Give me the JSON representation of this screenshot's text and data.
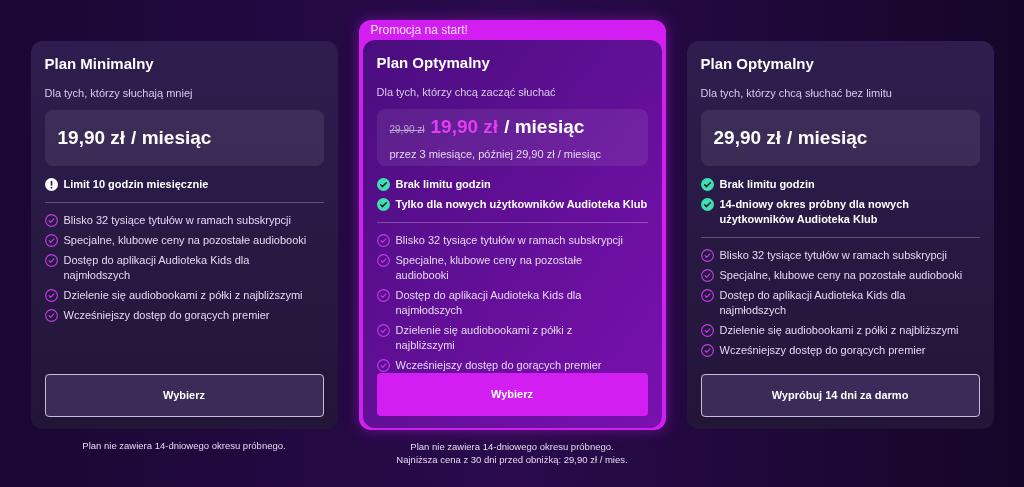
{
  "plans": [
    {
      "title": "Plan Minimalny",
      "subtitle": "Dla tych, którzy słuchają mniej",
      "price": {
        "amount": "19,90 zł",
        "unit": "/ miesiąc"
      },
      "highlights": [
        {
          "kind": "warning",
          "text": "Limit 10 godzin miesięcznie"
        }
      ],
      "features": [
        "Blisko 32 tysiące tytułów w ramach subskrypcji",
        "Specjalne, klubowe ceny na pozostałe audiobooki",
        "Dostęp do aplikacji Audioteka Kids dla najmłodszych",
        "Dzielenie się audiobookami z półki z najbliższymi",
        "Wcześniejszy dostęp do gorących premier"
      ],
      "button": {
        "label": "Wybierz",
        "primary": false
      },
      "footnotes": [
        "Plan nie zawiera 14-dniowego okresu próbnego."
      ]
    },
    {
      "badge": "Promocja na start!",
      "title": "Plan Optymalny",
      "subtitle": "Dla tych, którzy chcą zacząć słuchać",
      "price": {
        "old": "29,90 zł",
        "amount": "19,90 zł",
        "unit": "/ miesiąc",
        "note": "przez 3 miesiące, później 29,90 zł / miesiąc"
      },
      "highlights": [
        {
          "kind": "check",
          "text": "Brak limitu godzin"
        },
        {
          "kind": "check",
          "text": "Tylko dla nowych użytkowników Audioteka Klub"
        }
      ],
      "features": [
        "Blisko 32 tysiące tytułów w ramach subskrypcji",
        "Specjalne, klubowe ceny na pozostałe audiobooki",
        "Dostęp do aplikacji Audioteka Kids dla najmłodszych",
        "Dzielenie się audiobookami z półki z najbliższymi",
        "Wcześniejszy dostęp do gorących premier"
      ],
      "button": {
        "label": "Wybierz",
        "primary": true
      },
      "footnotes": [
        "Plan nie zawiera 14-dniowego okresu próbnego.",
        "Najniższa cena z 30 dni przed obniżką: 29,90 zł / mies."
      ]
    },
    {
      "title": "Plan Optymalny",
      "subtitle": "Dla tych, którzy chcą słuchać bez limitu",
      "price": {
        "amount": "29,90 zł",
        "unit": "/ miesiąc"
      },
      "highlights": [
        {
          "kind": "check",
          "text": "Brak limitu godzin"
        },
        {
          "kind": "check",
          "text": "14-dniowy okres próbny dla nowych użytkowników Audioteka Klub"
        }
      ],
      "features": [
        "Blisko 32 tysiące tytułów w ramach subskrypcji",
        "Specjalne, klubowe ceny na pozostałe audiobooki",
        "Dostęp do aplikacji Audioteka Kids dla najmłodszych",
        "Dzielenie się audiobookami z półki z najbliższymi",
        "Wcześniejszy dostęp do gorących premier"
      ],
      "button": {
        "label": "Wypróbuj 14 dni za darmo",
        "primary": false
      }
    }
  ]
}
